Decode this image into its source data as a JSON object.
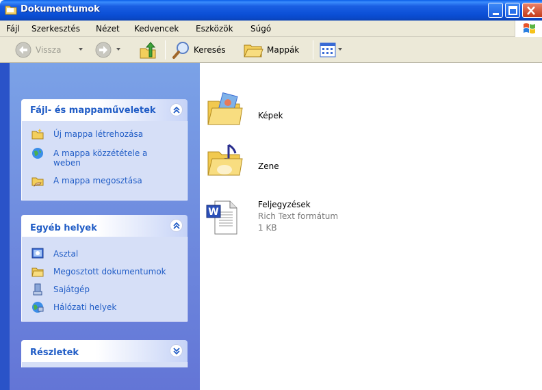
{
  "window": {
    "title": "Dokumentumok"
  },
  "menu": [
    {
      "label": "Fájl"
    },
    {
      "label": "Szerkesztés"
    },
    {
      "label": "Nézet"
    },
    {
      "label": "Kedvencek"
    },
    {
      "label": "Eszközök"
    },
    {
      "label": "Súgó"
    }
  ],
  "toolbar": {
    "back_label": "Vissza",
    "search_label": "Keresés",
    "folders_label": "Mappák"
  },
  "panels": {
    "file_tasks": {
      "title": "Fájl- és mappaműveletek",
      "items": [
        {
          "label": "Új mappa létrehozása",
          "icon": "new-folder-icon"
        },
        {
          "label": "A mappa közzététele a",
          "label2": "weben",
          "icon": "publish-web-icon"
        },
        {
          "label": "A mappa megosztása",
          "icon": "share-folder-icon"
        }
      ]
    },
    "other_places": {
      "title": "Egyéb helyek",
      "items": [
        {
          "label": "Asztal",
          "icon": "desktop-icon"
        },
        {
          "label": "Megosztott dokumentumok",
          "icon": "folder-icon"
        },
        {
          "label": "Sajátgép",
          "icon": "computer-icon"
        },
        {
          "label": "Hálózati helyek",
          "icon": "network-icon"
        }
      ]
    },
    "details": {
      "title": "Részletek"
    }
  },
  "files": [
    {
      "name": "Képek",
      "icon": "pictures-folder-icon"
    },
    {
      "name": "Zene",
      "icon": "music-folder-icon"
    },
    {
      "name": "Feljegyzések",
      "type": "Rich Text formátum",
      "size": "1 KB",
      "icon": "word-document-icon"
    }
  ],
  "colors": {
    "titlebar": "#0b4fd6",
    "taskpane_top": "#7ba2e7",
    "taskpane_bottom": "#6375d6",
    "task_link": "#215dc6",
    "panel_body": "#d6dff7",
    "chrome": "#ece9d8"
  }
}
